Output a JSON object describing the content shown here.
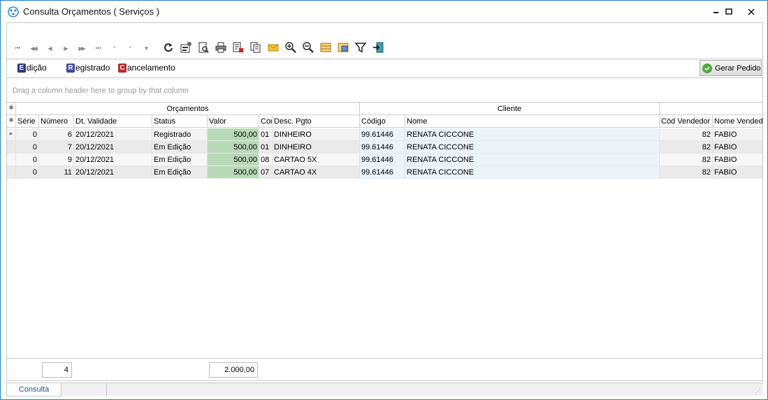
{
  "window": {
    "title": "Consulta Orçamentos ( Serviços )"
  },
  "navigation": [
    "⏮",
    "◀◀",
    "◀",
    "▶",
    "▶▶",
    "⏭",
    "*",
    "*",
    "▼"
  ],
  "legend": {
    "edicao": {
      "letter": "E",
      "label": "dição",
      "color": "#2a3a8a"
    },
    "registrado": {
      "letter": "R",
      "label": "egistrado",
      "color": "#3a4aa8"
    },
    "cancelamento": {
      "letter": "C",
      "label": "ancelamento",
      "color": "#c0262a"
    },
    "gerar_pedido": "Gerar Pedido"
  },
  "group_hint": "Drag a column header here to group by that column",
  "grid": {
    "bands": {
      "orcamentos": "Orçamentos",
      "cliente": "Cliente"
    },
    "columns": {
      "serie": "Série",
      "numero": "Número",
      "validade": "Dt. Validade",
      "status": "Status",
      "valor": "Valor",
      "cod": "Cod",
      "desc_pgto": "Desc. Pgto",
      "codigo": "Código",
      "nome": "Nome",
      "cod_vendedor": "Cód Vendedor",
      "nome_vendedor": "Nome Vendedor"
    },
    "rows": [
      {
        "serie": "0",
        "numero": "6",
        "validade": "20/12/2021",
        "status": "Registrado",
        "valor": "500,00",
        "cod": "01",
        "desc_pgto": "DINHEIRO",
        "codigo": "99.61446",
        "nome": "RENATA CICCONE",
        "cod_vendedor": "82",
        "nome_vendedor": "FABIO"
      },
      {
        "serie": "0",
        "numero": "7",
        "validade": "20/12/2021",
        "status": "Em Edição",
        "valor": "500,00",
        "cod": "01",
        "desc_pgto": "DINHEIRO",
        "codigo": "99.61446",
        "nome": "RENATA CICCONE",
        "cod_vendedor": "82",
        "nome_vendedor": "FABIO"
      },
      {
        "serie": "0",
        "numero": "9",
        "validade": "20/12/2021",
        "status": "Em Edição",
        "valor": "500,00",
        "cod": "08",
        "desc_pgto": "CARTAO 5X",
        "codigo": "99.61446",
        "nome": "RENATA CICCONE",
        "cod_vendedor": "82",
        "nome_vendedor": "FABIO"
      },
      {
        "serie": "0",
        "numero": "11",
        "validade": "20/12/2021",
        "status": "Em Edição",
        "valor": "500,00",
        "cod": "07",
        "desc_pgto": "CARTAO 4X",
        "codigo": "99.61446",
        "nome": "RENATA CICCONE",
        "cod_vendedor": "82",
        "nome_vendedor": "FABIO"
      }
    ]
  },
  "footer": {
    "count": "4",
    "total": "2.000,00"
  },
  "tabs": {
    "consulta": "Consulta"
  }
}
